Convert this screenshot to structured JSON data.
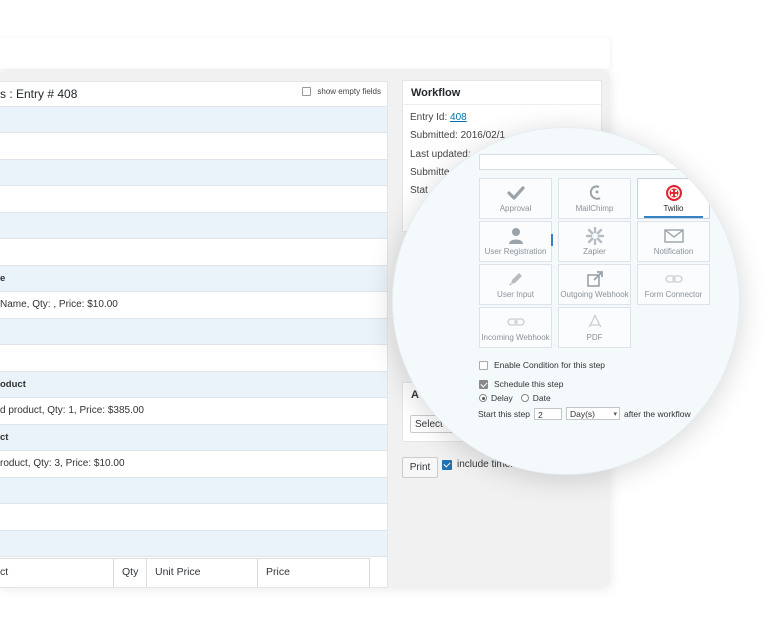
{
  "entry": {
    "title": "s : Entry # 408",
    "show_empty_label": "show empty fields",
    "rows": [
      {
        "type": "label",
        "text": ""
      },
      {
        "type": "value",
        "text": ""
      },
      {
        "type": "label",
        "text": ""
      },
      {
        "type": "value",
        "text": ""
      },
      {
        "type": "label",
        "text": ""
      },
      {
        "type": "value",
        "text": ""
      },
      {
        "type": "label",
        "text": "e"
      },
      {
        "type": "value",
        "text": "Name, Qty: , Price: $10.00"
      },
      {
        "type": "label",
        "text": ""
      },
      {
        "type": "value",
        "text": ""
      },
      {
        "type": "label",
        "text": "oduct"
      },
      {
        "type": "value",
        "text": "d product, Qty: 1, Price: $385.00"
      },
      {
        "type": "label",
        "text": "ct"
      },
      {
        "type": "value",
        "text": "roduct, Qty: 3, Price: $10.00"
      },
      {
        "type": "label",
        "text": ""
      },
      {
        "type": "value",
        "text": ""
      },
      {
        "type": "label",
        "text": ""
      }
    ],
    "table_headers": [
      "ct",
      "Qty",
      "Unit Price",
      "Price"
    ]
  },
  "workflow": {
    "title": "Workflow",
    "entry_id_label": "Entry Id:",
    "entry_id_value": "408",
    "submitted": "Submitted: 2016/02/1",
    "last_updated": "Last updated:",
    "submitted_by": "Submitte",
    "status": "Stat"
  },
  "admin": {
    "title": "A",
    "select_label": "Select a"
  },
  "footer": {
    "print_label": "Print",
    "timeline_label": "include timeline"
  },
  "lens": {
    "tiles": [
      {
        "label": "Approval",
        "icon": "checkmark-icon"
      },
      {
        "label": "MailChimp",
        "icon": "mailchimp-icon"
      },
      {
        "label": "Twilio",
        "icon": "twilio-icon",
        "selected": true
      },
      {
        "label": "User Registration",
        "icon": "user-icon"
      },
      {
        "label": "Zapier",
        "icon": "zapier-icon"
      },
      {
        "label": "Notification",
        "icon": "envelope-icon"
      },
      {
        "label": "User Input",
        "icon": "pencil-icon"
      },
      {
        "label": "Outgoing Webhook",
        "icon": "external-link-icon"
      },
      {
        "label": "Form Connector",
        "icon": "link-icon"
      },
      {
        "label": "Incoming Webhook",
        "icon": "link-icon"
      },
      {
        "label": "PDF",
        "icon": "pdf-icon"
      }
    ],
    "enable_condition": "Enable Condition for this step",
    "schedule": "Schedule this step",
    "delay": "Delay",
    "date": "Date",
    "start_prefix": "Start this step",
    "start_value": "2",
    "unit": "Day(s)",
    "start_suffix": "after the workflow"
  },
  "colors": {
    "accent": "#0073aa",
    "twilio": "#e0252f",
    "label_row": "#eaf2fa"
  }
}
